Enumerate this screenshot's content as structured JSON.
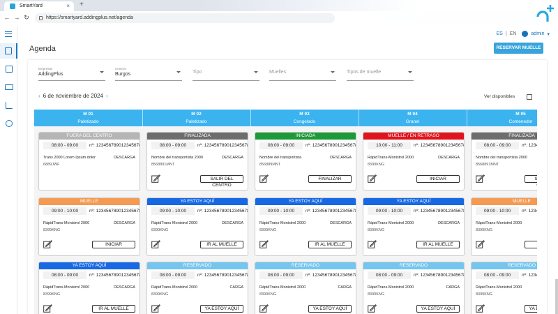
{
  "browser": {
    "tab_title": "SmartYard",
    "url": "https://smartyard.addingplus.net/agenda"
  },
  "colors": {
    "primary": "#39a4dc",
    "header_band": "#3bb3ef",
    "fuera": "#b5b5b5",
    "finalizada": "#6d6d6d",
    "iniciada": "#1d9a38",
    "retraso": "#e0141c",
    "muelle": "#f59a52",
    "ya_estoy": "#1668e3",
    "reservado": "#74c6ef"
  },
  "header": {
    "lang_es": "ES",
    "lang_en": "EN",
    "user": "admin"
  },
  "page": {
    "title": "Agenda",
    "reserve_button": "RESERVAR MUELLE"
  },
  "filters": {
    "empresas_label": "Empresas",
    "empresas_value": "AddingPlus",
    "centros_label": "Centros",
    "centros_value": "Burgos",
    "tipo_placeholder": "Tipo",
    "muelles_placeholder": "Muelles",
    "tipos_muelle_placeholder": "Tipos de muelle"
  },
  "date": {
    "label": "6 de noviembre de 2024",
    "ver_disponibles": "Ver disponibles"
  },
  "columns": [
    {
      "name": "M 01",
      "type": "Paletizado"
    },
    {
      "name": "M 02",
      "type": "Paletizado"
    },
    {
      "name": "M 03",
      "type": "Congelado"
    },
    {
      "name": "M 04",
      "type": "Granel"
    },
    {
      "name": "M 05",
      "type": "Contenedor"
    }
  ],
  "rows": [
    [
      {
        "status": "FUERA DEL CENTRO",
        "color": "#b5b5b5",
        "time": "08:00 - 09:00",
        "num": "nº: 12345678901234567890",
        "transport": "Trans 2000 Lorem Ipsum dolor",
        "op": "DESCARGA",
        "plate": "6889JWF",
        "action": ""
      },
      {
        "status": "FINALIZADA",
        "color": "#6d6d6d",
        "time": "08:00 - 09:00",
        "num": "nº: 12345678901234567890",
        "transport": "Nombre del transportista 2000",
        "op": "DESCARGA",
        "plate": "8568891MNT",
        "action": "SALIR DEL CENTRO"
      },
      {
        "status": "INICIADA",
        "color": "#1d9a38",
        "time": "08:00 - 09:00",
        "num": "nº: 12345678901234567890",
        "transport": "Nombre del transportista",
        "op": "DESCARGA",
        "plate": "856889MNT",
        "action": "FINALIZAR"
      },
      {
        "status": "MUELLE / EN RETRASO",
        "color": "#e0141c",
        "time": "10:00 - 11:00",
        "num": "nº: 12345678901234567890",
        "transport": "RápidTrans-Monistrol 2000",
        "op": "DESCARGA",
        "plate": "8399KNG",
        "action": "INICIAR"
      },
      {
        "status": "FINALIZADA",
        "color": "#6d6d6d",
        "time": "08:00 - 09:00",
        "num": "nº: 12345678901234567890",
        "transport": "Nombre del transportista 2000",
        "op": "DESCARGA",
        "plate": "8568891MNT",
        "action": "SALIR DEL CENTRO"
      }
    ],
    [
      {
        "status": "MUELLE",
        "color": "#f59a52",
        "time": "09:00 - 10:00",
        "num": "nº: 12345678901234567890",
        "transport": "RápidTrans-Monistrol 2000",
        "op": "DESCARGA",
        "plate": "8399KNG",
        "action": "INICIAR"
      },
      {
        "status": "YA ESTOY AQUÍ",
        "color": "#1668e3",
        "time": "09:00 - 10:00",
        "num": "nº: 12345678901234567890",
        "transport": "RápidTrans-Monistrol 2000",
        "op": "DESCARGA",
        "plate": "8399KNG",
        "action": "IR AL MUELLE"
      },
      {
        "status": "YA ESTOY AQUÍ",
        "color": "#1668e3",
        "time": "09:00 - 10:00",
        "num": "nº: 12345678901234567890",
        "transport": "RápidTrans-Monistrol 2000",
        "op": "DESCARGA",
        "plate": "8399KNG",
        "action": "IR AL MUELLE"
      },
      {
        "status": "YA ESTOY AQUÍ",
        "color": "#1668e3",
        "time": "09:00 - 10:00",
        "num": "nº: 12345678901234567890",
        "transport": "RápidTrans-Monistrol 2000",
        "op": "DESCARGA",
        "plate": "8399KNG",
        "action": "IR AL MUELLE"
      },
      {
        "status": "MUELLE",
        "color": "#f59a52",
        "time": "09:00 - 10:00",
        "num": "nº: 12345678901234567890",
        "transport": "RápidTrans-Monistrol 2000",
        "op": "DESCARGA",
        "plate": "8399KNG",
        "action": "INICIAR"
      }
    ],
    [
      {
        "status": "YA ESTOY AQUÍ",
        "color": "#1668e3",
        "time": "08:00 - 09:00",
        "num": "nº: 12345678901234567890",
        "transport": "RápidTrans-Monistrol 2000",
        "op": "DESCARGA",
        "plate": "8399KNG",
        "action": "IR AL MUELLE"
      },
      {
        "status": "RESERVADO",
        "color": "#74c6ef",
        "time": "08:00 - 09:00",
        "num": "nº: 12345678901234567890",
        "transport": "RápidTrans-Monistrol 2000",
        "op": "CARGA",
        "plate": "8399KNG",
        "action": "YA ESTOY AQUÍ"
      },
      {
        "status": "RESERVADO",
        "color": "#74c6ef",
        "time": "08:00 - 09:00",
        "num": "nº: 12345678901234567890",
        "transport": "RápidTrans-Monistrol 2000",
        "op": "CARGA",
        "plate": "8399KNG",
        "action": "YA ESTOY AQUÍ"
      },
      {
        "status": "RESERVADO",
        "color": "#74c6ef",
        "time": "08:00 - 09:00",
        "num": "nº: 12345678901234567890",
        "transport": "RápidTrans-Monistrol 2000",
        "op": "CARGA",
        "plate": "8399KNG",
        "action": "YA ESTOY AQUÍ"
      },
      {
        "status": "RESERVADO",
        "color": "#74c6ef",
        "time": "08:00 - 09:00",
        "num": "nº: 12345678901234567890",
        "transport": "RápidTrans-Monistrol 2000",
        "op": "CARGA",
        "plate": "8399KNG",
        "action": "YA ESTOY AQUÍ"
      }
    ]
  ]
}
